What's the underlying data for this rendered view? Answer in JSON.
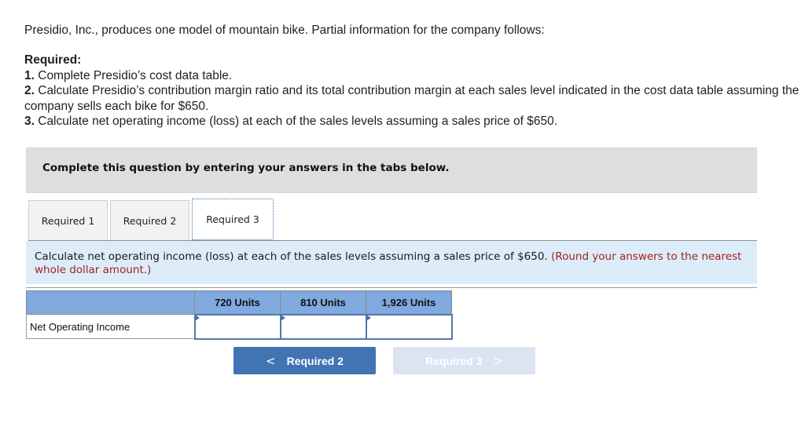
{
  "intro": "Presidio, Inc., produces one model of mountain bike. Partial information for the company follows:",
  "required": {
    "heading": "Required:",
    "items": [
      {
        "num": "1.",
        "text": " Complete Presidio’s cost data table."
      },
      {
        "num": "2.",
        "text": " Calculate Presidio’s contribution margin ratio and its total contribution margin at each sales level indicated in the cost data table assuming the company sells each bike for $650."
      },
      {
        "num": "3.",
        "text": " Calculate net operating income (loss) at each of the sales levels assuming a sales price of $650."
      }
    ]
  },
  "banner": "Complete this question by entering your answers in the tabs below.",
  "tabs": [
    {
      "label": "Required 1",
      "active": false
    },
    {
      "label": "Required 2",
      "active": false
    },
    {
      "label": "Required 3",
      "active": true
    }
  ],
  "question": {
    "text": "Calculate net operating income (loss) at each of the sales levels assuming a sales price of $650.",
    "hint": "(Round your answers to the nearest whole dollar amount.)"
  },
  "table": {
    "columns": [
      "720 Units",
      "810 Units",
      "1,926 Units"
    ],
    "rows": [
      {
        "label": "Net Operating Income",
        "values": [
          "",
          "",
          ""
        ]
      }
    ]
  },
  "nav": {
    "prev_label": "Required 2",
    "next_label": "Required 3",
    "prev_icon": "chevron-left-icon",
    "next_icon": "chevron-right-icon"
  },
  "colors": {
    "header_blue": "#7fa9df",
    "button_blue": "#4274b4",
    "button_disabled": "#dbe4f0",
    "hint_red": "#a52020",
    "question_bg": "#ddecf9"
  }
}
